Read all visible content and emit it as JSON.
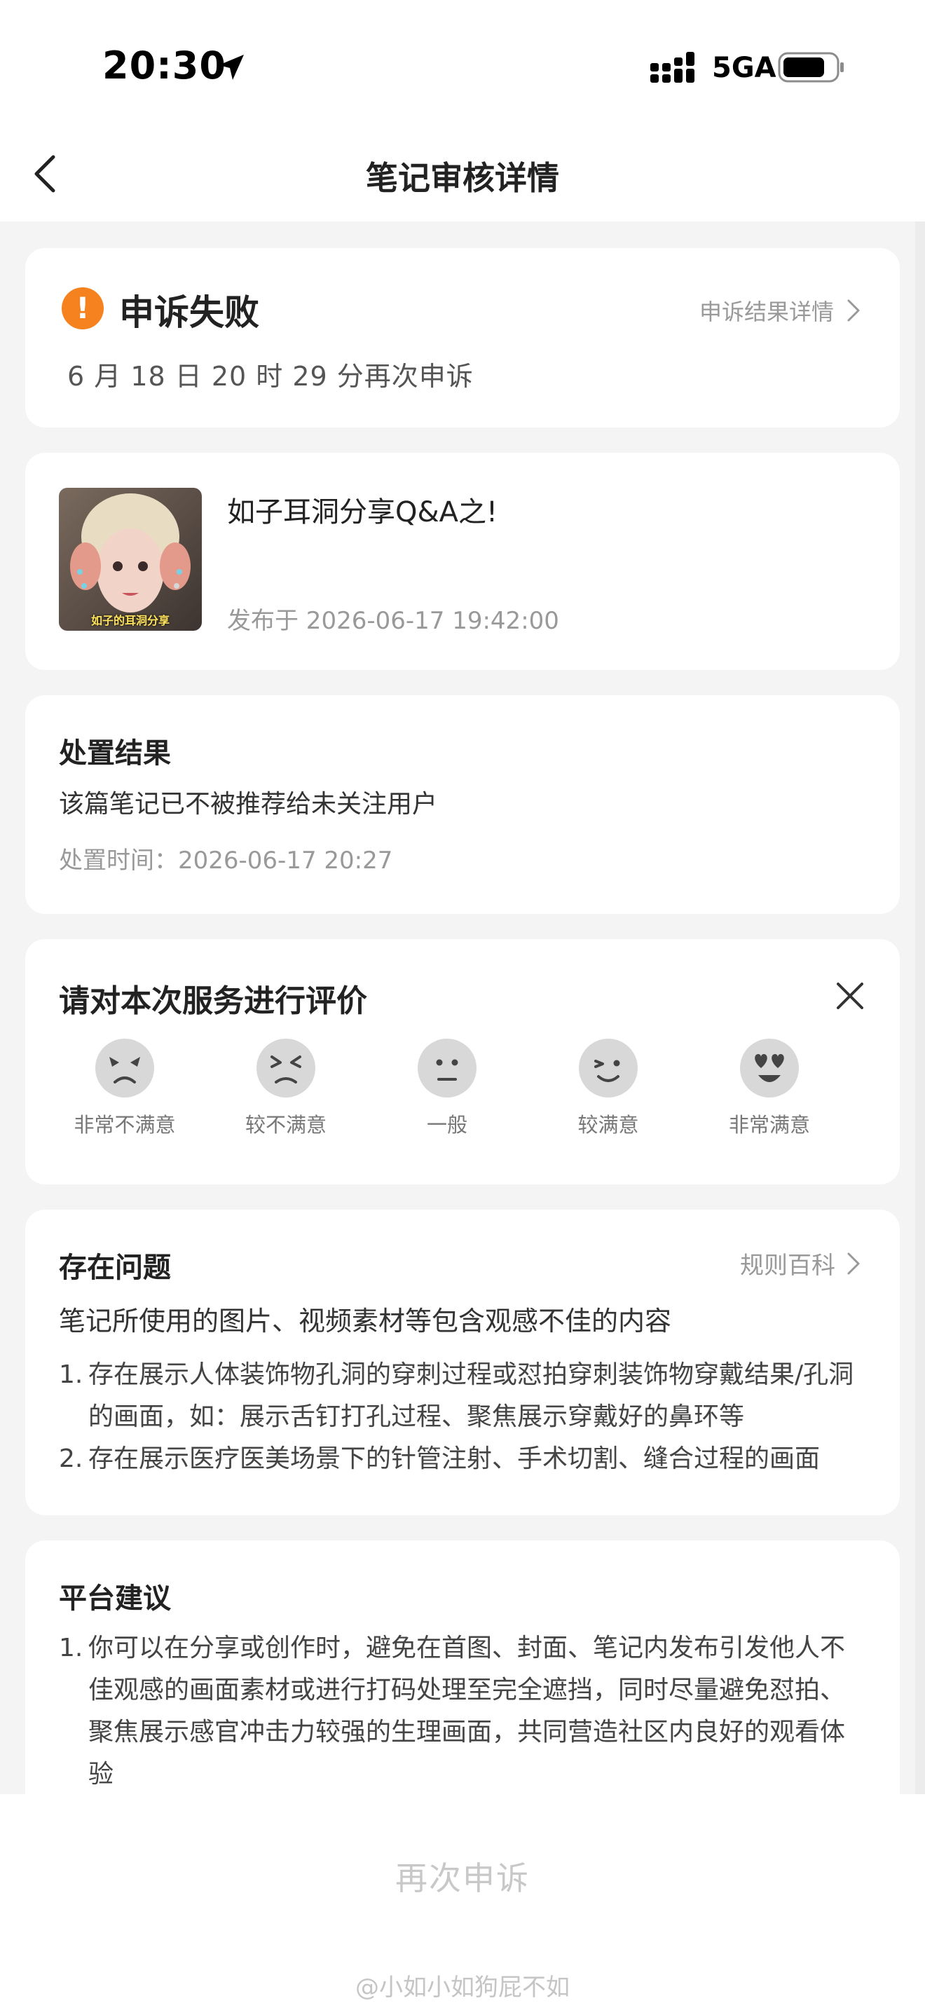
{
  "status_bar": {
    "time": "20:30",
    "network": "5GA"
  },
  "nav": {
    "title": "笔记审核详情",
    "back_icon": "chevron-left-icon"
  },
  "appeal": {
    "status": "申诉失败",
    "detail_link": "申诉结果详情",
    "subtitle": "6 月 18 日 20 时 29 分再次申诉",
    "status_color": "#f5821f"
  },
  "note": {
    "title": "如子耳洞分享Q&A之!",
    "published": "发布于 2026-06-17 19:42:00",
    "thumb_caption": "如子的耳洞分享"
  },
  "result": {
    "heading": "处置结果",
    "description": "该篇笔记已不被推荐给未关注用户",
    "time": "处置时间：2026-06-17 20:27"
  },
  "rating": {
    "title": "请对本次服务进行评价",
    "options": [
      {
        "label": "非常不满意",
        "icon": "very-dissatisfied-face-icon"
      },
      {
        "label": "较不满意",
        "icon": "dissatisfied-face-icon"
      },
      {
        "label": "一般",
        "icon": "neutral-face-icon"
      },
      {
        "label": "较满意",
        "icon": "satisfied-face-icon"
      },
      {
        "label": "非常满意",
        "icon": "very-satisfied-face-icon"
      }
    ]
  },
  "issue": {
    "heading": "存在问题",
    "link": "规则百科",
    "summary": "笔记所使用的图片、视频素材等包含观感不佳的内容",
    "items": [
      {
        "num": "1.",
        "lines": [
          "存在展示人体装饰物孔洞的穿刺过程或怼拍穿刺装饰物穿戴结果/孔洞",
          "的画面，如：展示舌钉打孔过程、聚焦展示穿戴好的鼻环等"
        ]
      },
      {
        "num": "2.",
        "lines": [
          "存在展示医疗医美场景下的针管注射、手术切割、缝合过程的画面"
        ]
      }
    ]
  },
  "advice": {
    "heading": "平台建议",
    "items": [
      {
        "num": "1.",
        "lines": [
          "你可以在分享或创作时，避免在首图、封面、笔记内发布引发他人不",
          "佳观感的画面素材或进行打码处理至完全遮挡，同时尽量避免怼拍、",
          "聚焦展示感官冲击力较强的生理画面，共同营造社区内良好的观看体",
          "验"
        ]
      }
    ]
  },
  "bottom": {
    "button": "再次申诉",
    "watermark": "@小如小如狗屁不如"
  }
}
